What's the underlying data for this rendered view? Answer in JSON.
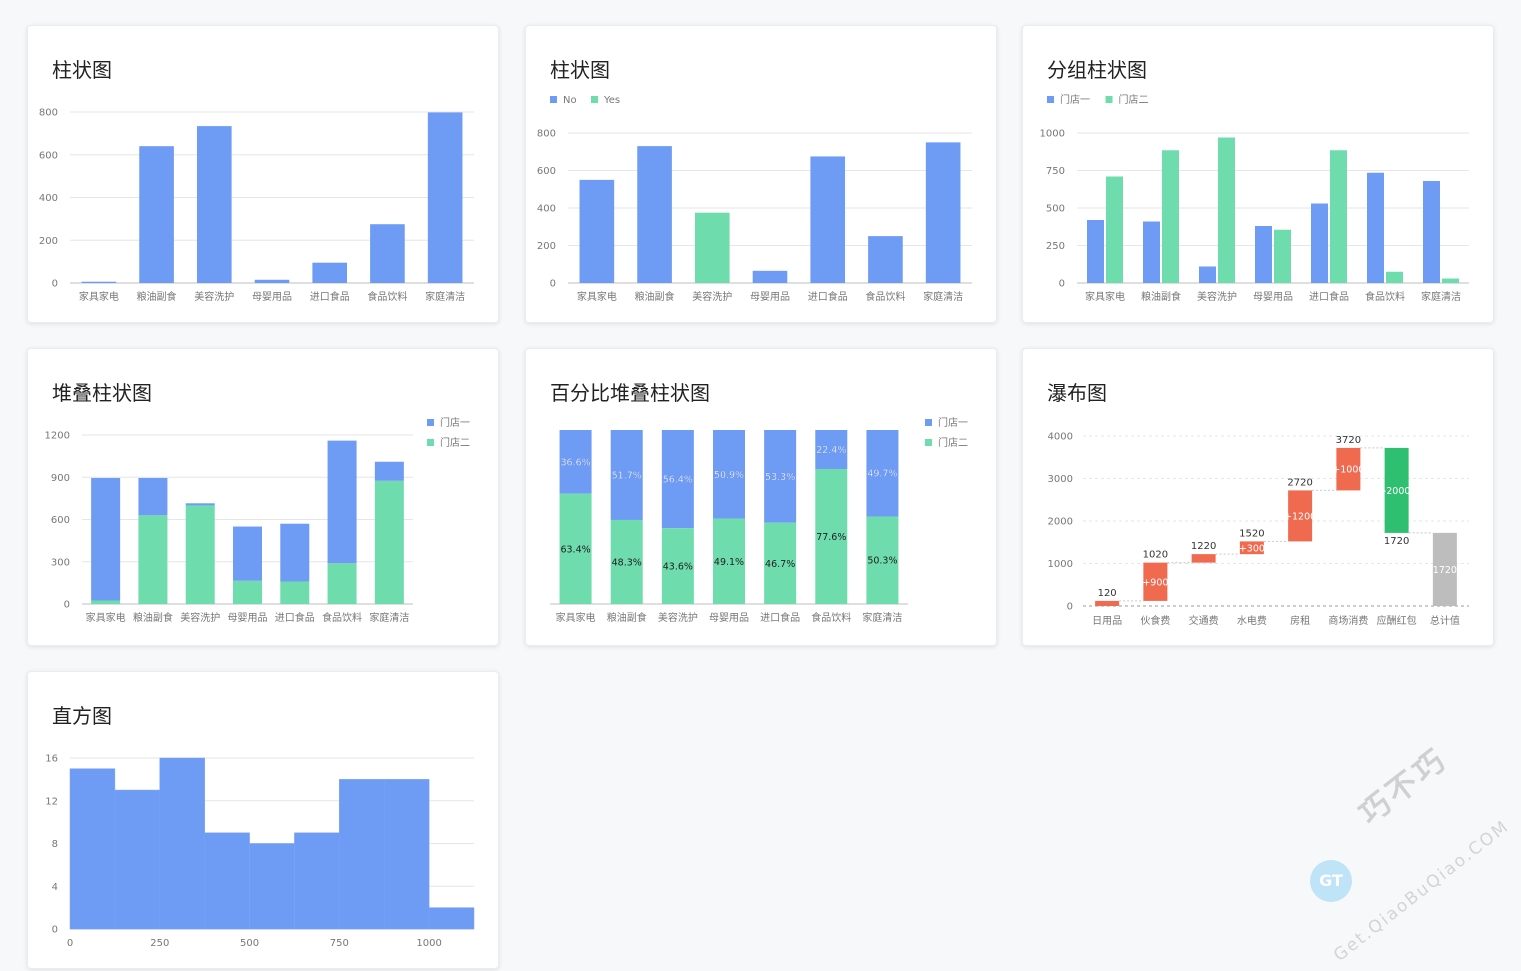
{
  "colors": {
    "blue": "#6e9bf3",
    "green": "#6edcad",
    "grid": "#e6e6e6",
    "axis": "#bfbfbf",
    "tick": "#777777",
    "increase": "#ef6a4f",
    "decrease": "#2fbf71",
    "total": "#bdbdbd"
  },
  "cards": [
    {
      "title": "柱状图"
    },
    {
      "title": "柱状图"
    },
    {
      "title": "分组柱状图"
    },
    {
      "title": "堆叠柱状图"
    },
    {
      "title": "百分比堆叠柱状图"
    },
    {
      "title": "瀑布图"
    },
    {
      "title": "直方图"
    }
  ],
  "chart_data": [
    {
      "type": "bar",
      "title": "柱状图",
      "categories": [
        "家具家电",
        "粮油副食",
        "美容洗护",
        "母婴用品",
        "进口食品",
        "食品饮料",
        "家庭清洁"
      ],
      "values": [
        6,
        640,
        734,
        15,
        95,
        275,
        798
      ],
      "ylim": [
        0,
        800
      ],
      "yticks": [
        0,
        200,
        400,
        600,
        800
      ],
      "grid": true
    },
    {
      "type": "bar",
      "title": "柱状图",
      "categories": [
        "家具家电",
        "粮油副食",
        "美容洗护",
        "母婴用品",
        "进口食品",
        "食品饮料",
        "家庭清洁"
      ],
      "values": [
        550,
        730,
        375,
        65,
        675,
        250,
        750
      ],
      "flags": [
        "No",
        "No",
        "Yes",
        "No",
        "No",
        "No",
        "No"
      ],
      "legend": [
        "No",
        "Yes"
      ],
      "legend_position": "top-left",
      "ylim": [
        0,
        800
      ],
      "yticks": [
        0,
        200,
        400,
        600,
        800
      ],
      "grid": true
    },
    {
      "type": "bar",
      "title": "分组柱状图",
      "categories": [
        "家具家电",
        "粮油副食",
        "美容洗护",
        "母婴用品",
        "进口食品",
        "食品饮料",
        "家庭清洁"
      ],
      "series": [
        {
          "name": "门店一",
          "values": [
            420,
            410,
            110,
            380,
            530,
            735,
            680
          ]
        },
        {
          "name": "门店二",
          "values": [
            710,
            885,
            970,
            355,
            885,
            75,
            30
          ]
        }
      ],
      "legend_position": "top-left",
      "ylim": [
        0,
        1000
      ],
      "yticks": [
        0,
        250,
        500,
        750,
        1000
      ],
      "grid": true
    },
    {
      "type": "bar",
      "title": "堆叠柱状图",
      "categories": [
        "家具家电",
        "粮油副食",
        "美容洗护",
        "母婴用品",
        "进口食品",
        "食品饮料",
        "家庭清洁"
      ],
      "series": [
        {
          "name": "门店一",
          "values": [
            870,
            265,
            15,
            385,
            410,
            870,
            135
          ]
        },
        {
          "name": "门店二",
          "values": [
            25,
            630,
            700,
            165,
            160,
            290,
            875
          ]
        }
      ],
      "stacked": true,
      "legend_position": "top-right",
      "ylim": [
        0,
        1200
      ],
      "yticks": [
        0,
        300,
        600,
        900,
        1200
      ],
      "grid": true
    },
    {
      "type": "bar",
      "title": "百分比堆叠柱状图",
      "categories": [
        "家具家电",
        "粮油副食",
        "美容洗护",
        "母婴用品",
        "进口食品",
        "食品饮料",
        "家庭清洁"
      ],
      "series": [
        {
          "name": "门店一",
          "values": [
            36.6,
            51.7,
            56.4,
            50.9,
            53.3,
            22.4,
            49.7
          ],
          "labels": [
            "36.6%",
            "51.7%",
            "56.4%",
            "50.9%",
            "53.3%",
            "22.4%",
            "49.7%"
          ]
        },
        {
          "name": "门店二",
          "values": [
            63.4,
            48.3,
            43.6,
            49.1,
            46.7,
            77.6,
            50.3
          ],
          "labels": [
            "63.4%",
            "48.3%",
            "43.6%",
            "49.1%",
            "46.7%",
            "77.6%",
            "50.3%"
          ]
        }
      ],
      "stacked": true,
      "percent": true,
      "legend_position": "top-right"
    },
    {
      "type": "bar",
      "title": "瀑布图",
      "categories": [
        "日用品",
        "伙食费",
        "交通费",
        "水电费",
        "房租",
        "商场消费",
        "应酬红包",
        "总计值"
      ],
      "steps": [
        {
          "start": 0,
          "end": 120,
          "kind": "increase",
          "top_label": "120",
          "inner_label": ""
        },
        {
          "start": 120,
          "end": 1020,
          "kind": "increase",
          "top_label": "1020",
          "inner_label": "+900"
        },
        {
          "start": 1020,
          "end": 1220,
          "kind": "increase",
          "top_label": "1220",
          "inner_label": ""
        },
        {
          "start": 1220,
          "end": 1520,
          "kind": "increase",
          "top_label": "1520",
          "inner_label": "+300"
        },
        {
          "start": 1520,
          "end": 2720,
          "kind": "increase",
          "top_label": "2720",
          "inner_label": "+1200"
        },
        {
          "start": 2720,
          "end": 3720,
          "kind": "increase",
          "top_label": "3720",
          "inner_label": "+1000"
        },
        {
          "start": 3720,
          "end": 1720,
          "kind": "decrease",
          "bottom_label": "1720",
          "inner_label": "-2000"
        },
        {
          "start": 0,
          "end": 1720,
          "kind": "total",
          "inner_label": "1720"
        }
      ],
      "ylim": [
        0,
        4000
      ],
      "yticks": [
        0,
        1000,
        2000,
        3000,
        4000
      ],
      "grid": true
    },
    {
      "type": "bar",
      "title": "直方图",
      "bins": [
        {
          "x0": 0,
          "x1": 125,
          "count": 15
        },
        {
          "x0": 125,
          "x1": 250,
          "count": 13
        },
        {
          "x0": 250,
          "x1": 375,
          "count": 16
        },
        {
          "x0": 375,
          "x1": 500,
          "count": 9
        },
        {
          "x0": 500,
          "x1": 625,
          "count": 8
        },
        {
          "x0": 625,
          "x1": 750,
          "count": 9
        },
        {
          "x0": 750,
          "x1": 875,
          "count": 14
        },
        {
          "x0": 875,
          "x1": 1000,
          "count": 14
        },
        {
          "x0": 1000,
          "x1": 1125,
          "count": 2
        }
      ],
      "xlim": [
        0,
        1125
      ],
      "xticks": [
        0,
        250,
        500,
        750,
        1000
      ],
      "ylim": [
        0,
        16
      ],
      "yticks": [
        0,
        4,
        8,
        12,
        16
      ],
      "grid": true
    }
  ],
  "watermark": {
    "badge": "GT",
    "brand": "巧不巧",
    "url": "Get.QiaoBuQiao.COM"
  }
}
